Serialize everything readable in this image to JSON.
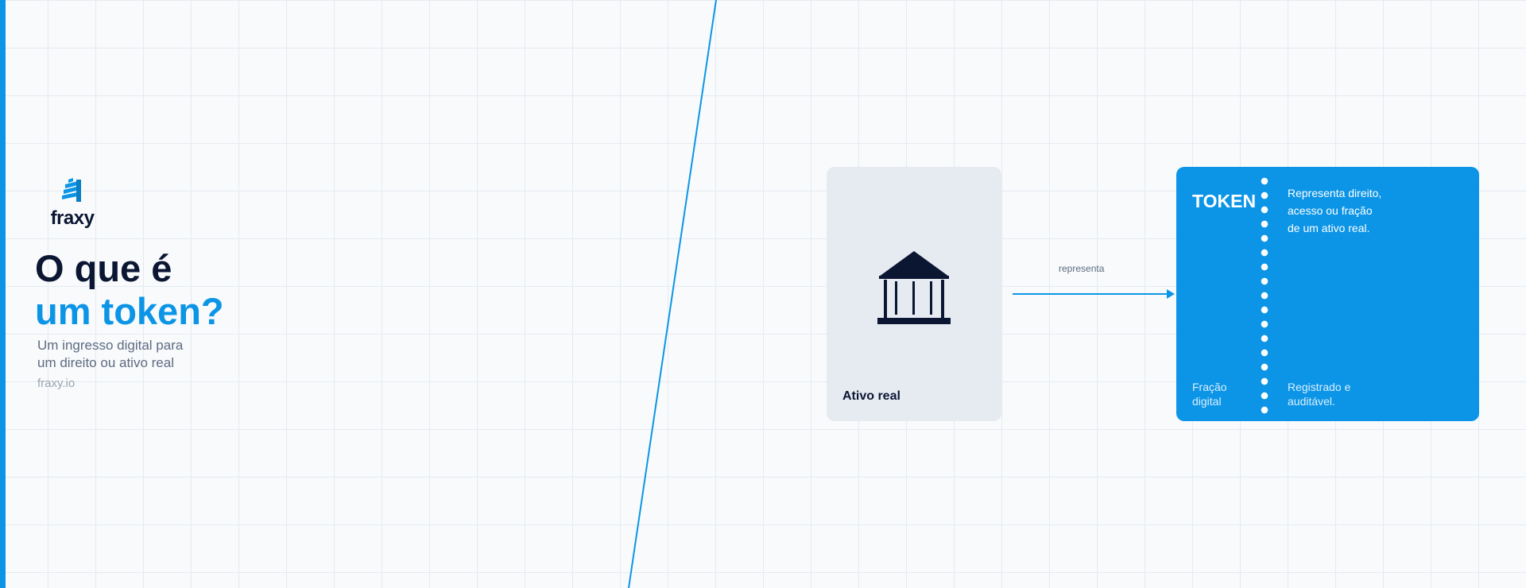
{
  "brand": {
    "name": "fraxy",
    "site": "fraxy.io",
    "logo_icon": "building-stripes-icon"
  },
  "headline": {
    "line1": "O que é",
    "line2": "um token?"
  },
  "subtitle": {
    "lines": [
      "Um ingresso digital para",
      "um direito ou ativo real"
    ]
  },
  "diagram": {
    "asset_card": {
      "icon": "bank-building-icon",
      "label": "Ativo real"
    },
    "arrow": {
      "label": "representa"
    },
    "token_card": {
      "title": "TOKEN",
      "description_lines": [
        "Representa direito,",
        "acesso ou fração",
        "de um ativo real."
      ],
      "fraction_lines": [
        "Fração",
        "digital"
      ],
      "registry_lines": [
        "Registrado e",
        "auditável."
      ]
    }
  },
  "colors": {
    "accent": "#0c95e6",
    "navy": "#0b1633",
    "background": "#f8fafc",
    "asset_card": "#e6ebf2",
    "muted_text": "#5d6b80"
  }
}
